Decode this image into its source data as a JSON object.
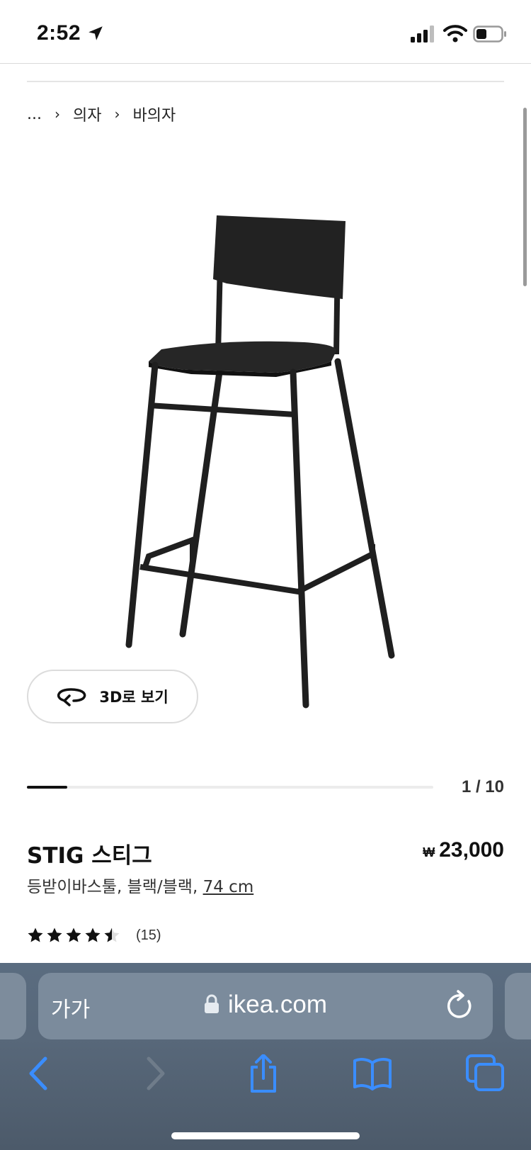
{
  "status_bar": {
    "time": "2:52"
  },
  "breadcrumb": {
    "ellipsis": "...",
    "items": [
      "의자",
      "바의자"
    ]
  },
  "gallery": {
    "view_3d_label": "3D로 보기",
    "counter": "1 / 10",
    "progress_fraction": 0.1
  },
  "product": {
    "name": "STIG 스티그",
    "currency_symbol": "₩",
    "price": "23,000",
    "description": "등받이바스툴, 블랙/블랙, ",
    "size": "74 cm",
    "rating": 4.5,
    "rating_max": 5,
    "review_count": "(15)"
  },
  "browser": {
    "text_size_button": "가가",
    "url": "ikea.com",
    "accent_color": "#3a8dff"
  }
}
